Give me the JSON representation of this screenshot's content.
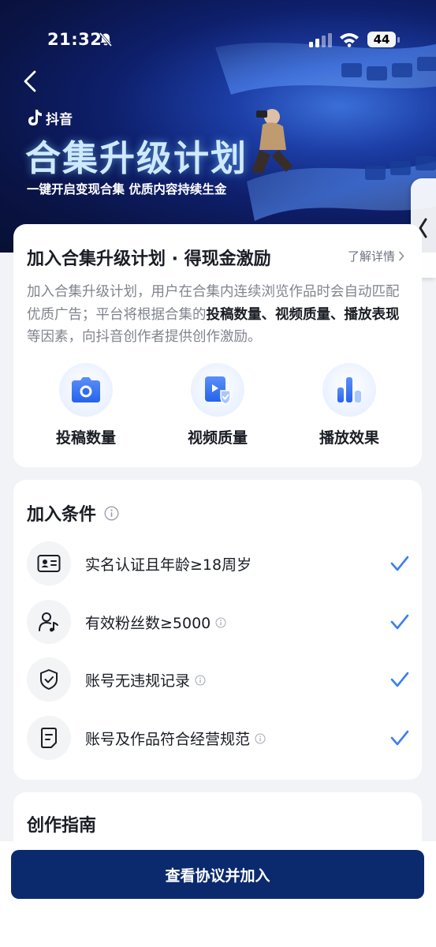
{
  "status_bar": {
    "time": "21:32",
    "battery": "44"
  },
  "hero": {
    "brand": "抖音",
    "title": "合集升级计划",
    "subtitle": "一键开启变现合集  优质内容持续生金"
  },
  "intro_card": {
    "title": "加入合集升级计划 · 得现金激励",
    "learn_more": "了解详情",
    "desc_part1": "加入合集升级计划，用户在合集内连续浏览作品时会自动匹配优质广告；平台将根据合集的",
    "desc_bold": "投稿数量、视频质量、播放表现",
    "desc_part2": "等因素，向抖音创作者提供创作激励。",
    "features": [
      {
        "label": "投稿数量",
        "icon": "camera-icon"
      },
      {
        "label": "视频质量",
        "icon": "video-quality-icon"
      },
      {
        "label": "播放效果",
        "icon": "bar-chart-icon"
      }
    ]
  },
  "conditions_card": {
    "title": "加入条件",
    "items": [
      {
        "label": "实名认证且年龄≥18周岁",
        "icon": "id-card-icon",
        "has_info": false
      },
      {
        "label": "有效粉丝数≥5000",
        "icon": "user-music-icon",
        "has_info": true
      },
      {
        "label": "账号无违规记录",
        "icon": "shield-check-icon",
        "has_info": true
      },
      {
        "label": "账号及作品符合经营规范",
        "icon": "document-icon",
        "has_info": true
      }
    ]
  },
  "guide_card": {
    "title": "创作指南"
  },
  "footer": {
    "join_button": "查看协议并加入"
  },
  "colors": {
    "primary_button": "#0b2a6e",
    "check": "#3b7ef0",
    "accent_blue": "#2e6df5"
  }
}
